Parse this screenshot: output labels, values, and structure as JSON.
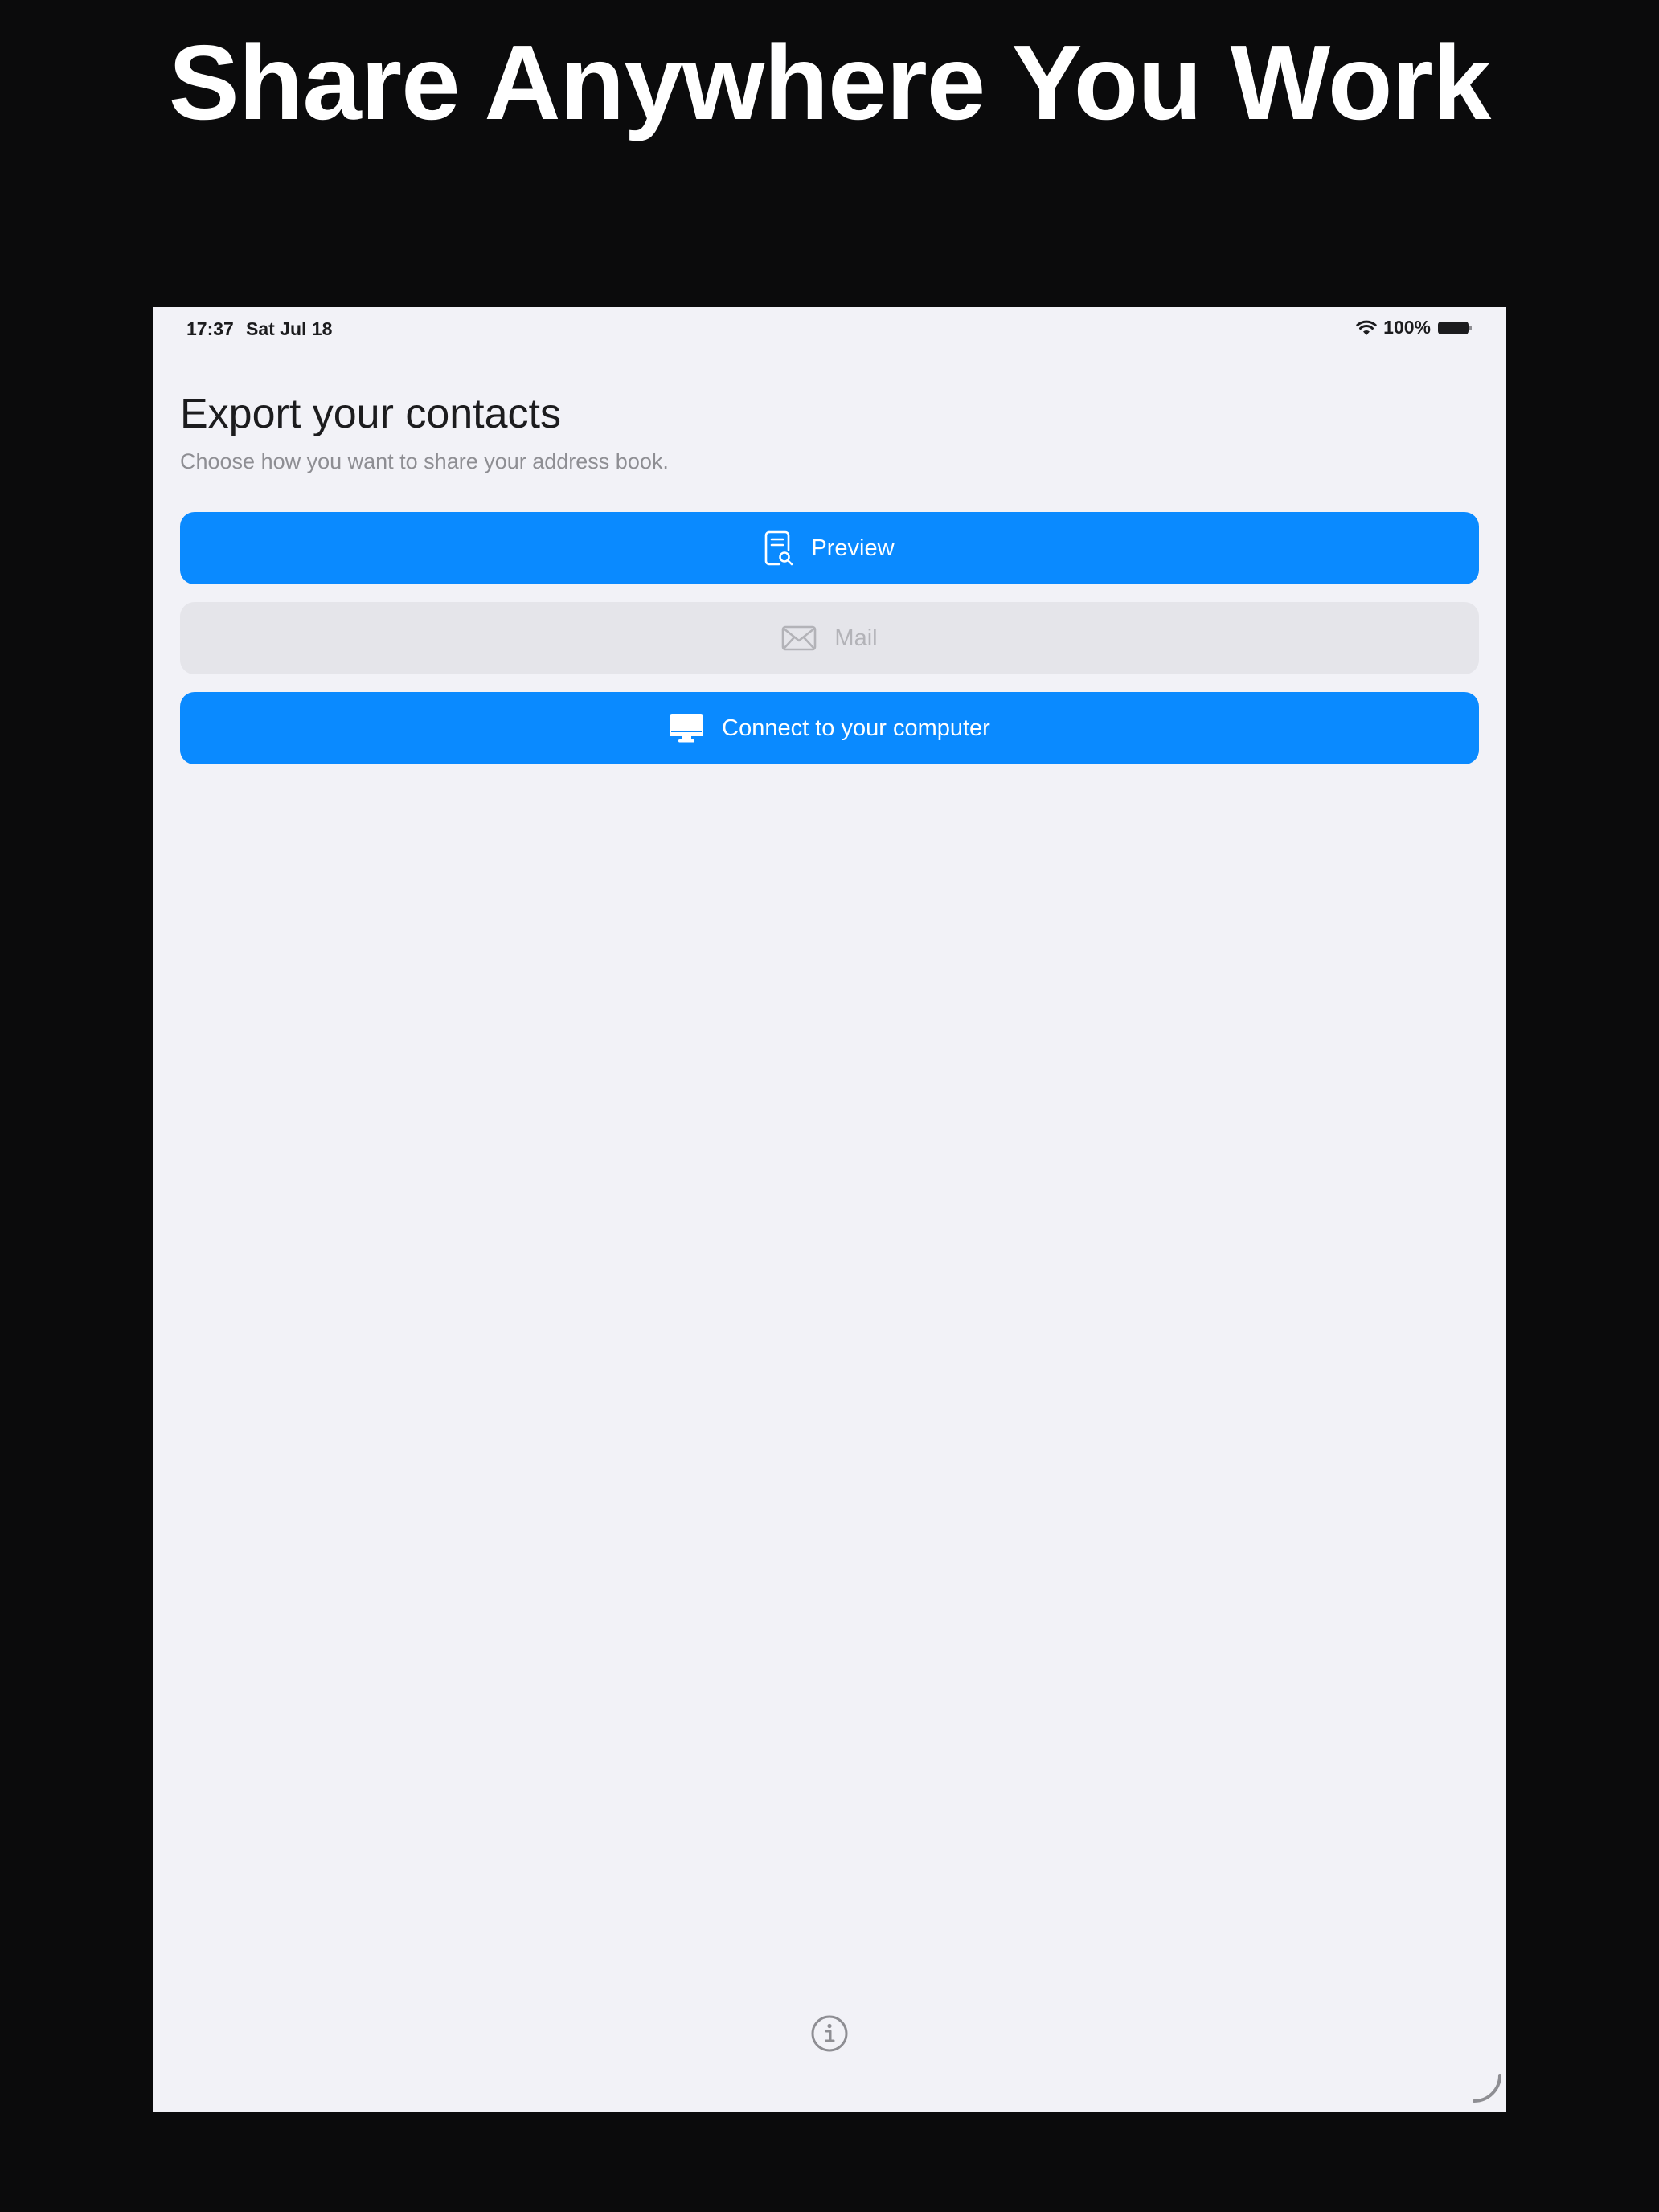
{
  "headline": "Share Anywhere You Work",
  "status_bar": {
    "time": "17:37",
    "date": "Sat Jul 18",
    "battery_percent": "100%",
    "icons": [
      "wifi-icon",
      "battery-icon"
    ]
  },
  "page": {
    "title": "Export your contacts",
    "subtitle": "Choose how you want to share your address book."
  },
  "actions": {
    "preview": {
      "label": "Preview",
      "icon": "document-preview-icon",
      "enabled": true
    },
    "mail": {
      "label": "Mail",
      "icon": "envelope-icon",
      "enabled": false
    },
    "connect": {
      "label": "Connect to your computer",
      "icon": "desktop-computer-icon",
      "enabled": true
    }
  },
  "footer": {
    "icon": "info-icon"
  },
  "colors": {
    "accent": "#0a8aff",
    "background": "#f2f2f7",
    "disabled_bg": "#e5e5ea",
    "frame": "#0b0b0c"
  }
}
